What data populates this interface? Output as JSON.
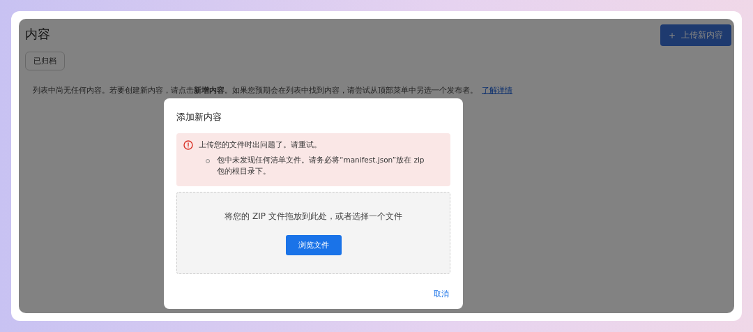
{
  "page": {
    "title": "内容",
    "upload_button": {
      "icon": "+",
      "label": "上传新内容"
    },
    "filters": [
      {
        "label": "已归档",
        "selected": false
      }
    ],
    "empty_message": {
      "text": "列表中尚无任何内容。若要创建新内容，请点击**新增内容**。如果您预期会在列表中找到内容，请尝试从顶部菜单中另选一个发布者。",
      "link": "了解详情"
    }
  },
  "dialog": {
    "title": "添加新内容",
    "error": {
      "message": "上传您的文件时出问题了。请重试。",
      "details": [
        "包中未发现任何清单文件。请务必将“manifest.json”放在 zip 包的根目录下。"
      ]
    },
    "dropzone": {
      "prompt": "将您的 ZIP 文件拖放到此处，或者选择一个文件",
      "button": "浏览文件"
    },
    "cancel": "取消"
  }
}
